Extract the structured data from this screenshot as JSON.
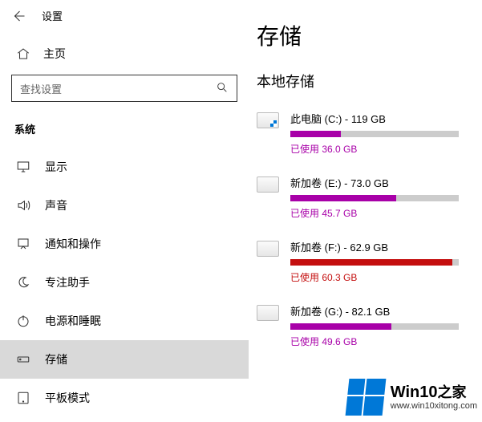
{
  "header": {
    "title": "设置"
  },
  "home": {
    "label": "主页"
  },
  "search": {
    "placeholder": "查找设置"
  },
  "category": "系统",
  "nav": {
    "items": [
      {
        "icon": "display-icon",
        "label": "显示"
      },
      {
        "icon": "sound-icon",
        "label": "声音"
      },
      {
        "icon": "notify-icon",
        "label": "通知和操作"
      },
      {
        "icon": "focus-icon",
        "label": "专注助手"
      },
      {
        "icon": "power-icon",
        "label": "电源和睡眠"
      },
      {
        "icon": "storage-icon",
        "label": "存储",
        "selected": true
      },
      {
        "icon": "tablet-icon",
        "label": "平板模式"
      }
    ]
  },
  "main": {
    "title": "存储",
    "subtitle": "本地存储",
    "drives": [
      {
        "name": "此电脑 (C:) - 119 GB",
        "used_text": "已使用 36.0 GB",
        "pct": 30,
        "win": true,
        "color": "purple"
      },
      {
        "name": "新加卷 (E:) - 73.0 GB",
        "used_text": "已使用 45.7 GB",
        "pct": 63,
        "color": "purple"
      },
      {
        "name": "新加卷 (F:) - 62.9 GB",
        "used_text": "已使用 60.3 GB",
        "pct": 96,
        "color": "red"
      },
      {
        "name": "新加卷 (G:) - 82.1 GB",
        "used_text": "已使用 49.6 GB",
        "pct": 60,
        "color": "purple"
      }
    ]
  },
  "watermark": {
    "brand": "Win10",
    "brand_suffix": "之家",
    "url": "www.win10xitong.com"
  }
}
